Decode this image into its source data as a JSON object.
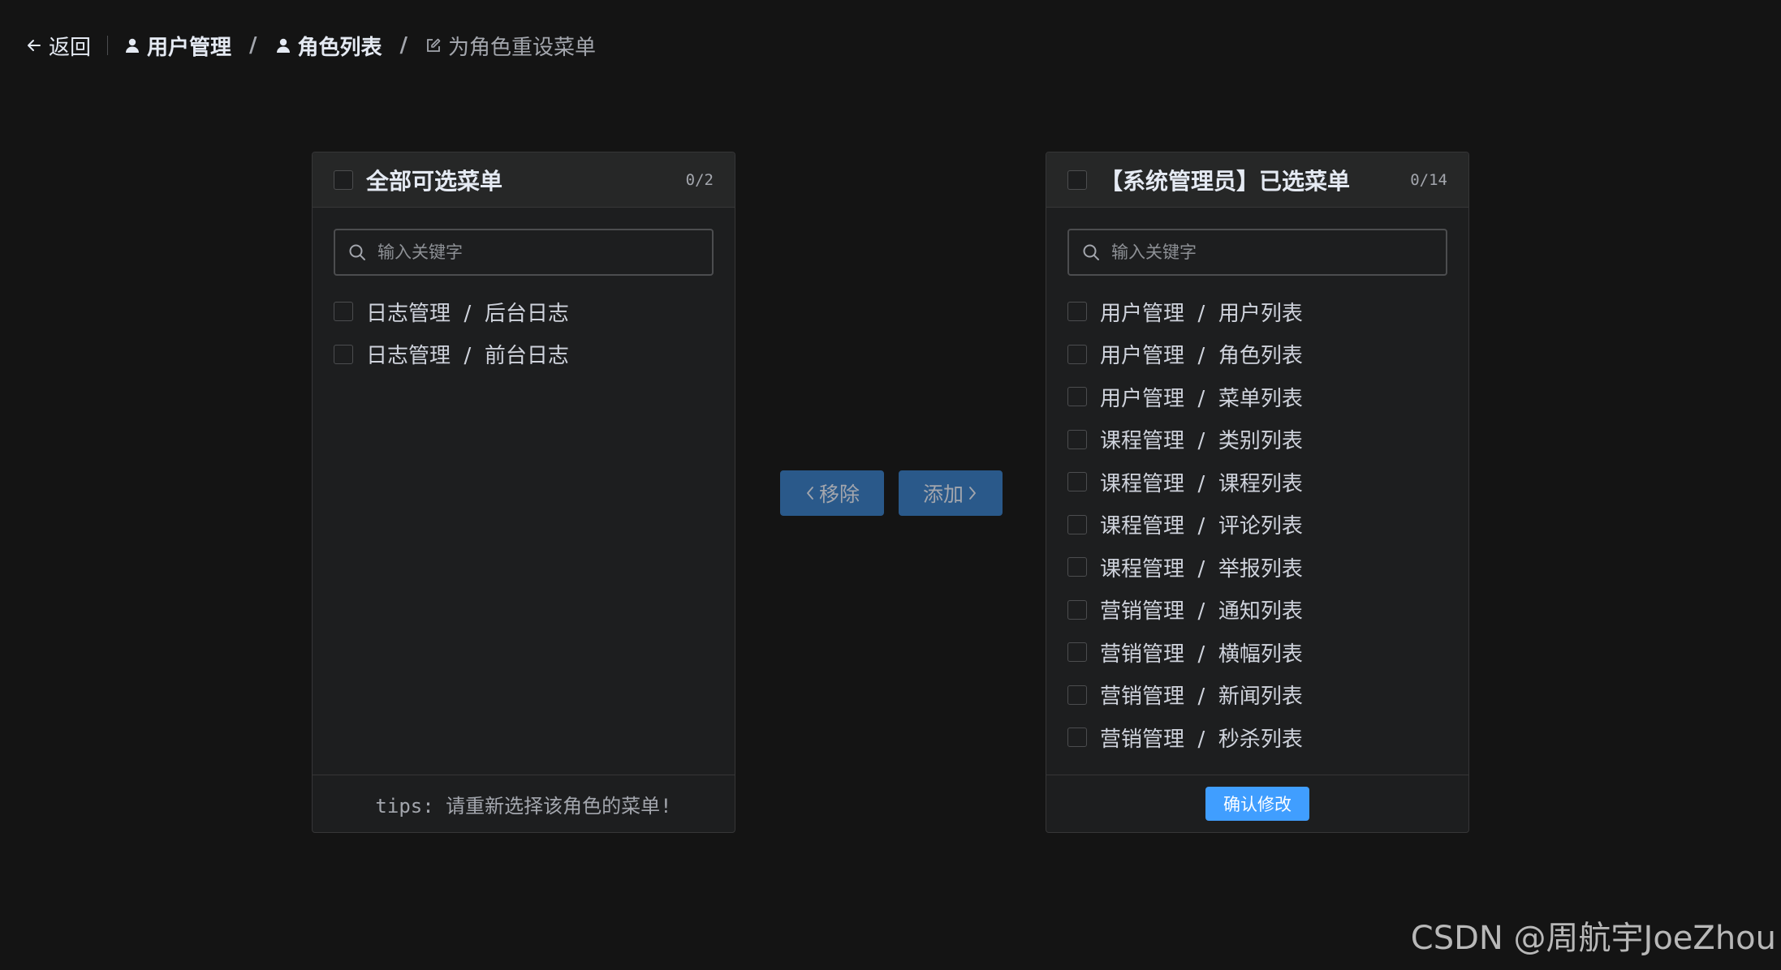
{
  "header": {
    "back_label": "返回",
    "breadcrumb": [
      {
        "label": "用户管理",
        "icon": "user-icon"
      },
      {
        "label": "角色列表",
        "icon": "user-icon"
      },
      {
        "label": "为角色重设菜单",
        "icon": "edit-icon"
      }
    ],
    "separator": "/"
  },
  "left_panel": {
    "title": "全部可选菜单",
    "count": "0/2",
    "search_placeholder": "输入关键字",
    "items": [
      {
        "label": "日志管理  /  后台日志",
        "checked": false
      },
      {
        "label": "日志管理  /  前台日志",
        "checked": false
      }
    ],
    "footer_tips": "tips: 请重新选择该角色的菜单!"
  },
  "right_panel": {
    "title": "【系统管理员】已选菜单",
    "count": "0/14",
    "search_placeholder": "输入关键字",
    "items": [
      {
        "label": "用户管理  /  用户列表",
        "checked": false
      },
      {
        "label": "用户管理  /  角色列表",
        "checked": false
      },
      {
        "label": "用户管理  /  菜单列表",
        "checked": false
      },
      {
        "label": "课程管理  /  类别列表",
        "checked": false
      },
      {
        "label": "课程管理  /  课程列表",
        "checked": false
      },
      {
        "label": "课程管理  /  评论列表",
        "checked": false
      },
      {
        "label": "课程管理  /  举报列表",
        "checked": false
      },
      {
        "label": "营销管理  /  通知列表",
        "checked": false
      },
      {
        "label": "营销管理  /  横幅列表",
        "checked": false
      },
      {
        "label": "营销管理  /  新闻列表",
        "checked": false
      },
      {
        "label": "营销管理  /  秒杀列表",
        "checked": false
      }
    ],
    "confirm_label": "确认修改"
  },
  "transfer": {
    "remove_label": "移除",
    "add_label": "添加"
  },
  "watermark": "CSDN @周航宇JoeZhou",
  "colors": {
    "background": "#141414",
    "panel": "#1d1e1f",
    "primary": "#409eff",
    "primary_disabled": "#2a598a"
  }
}
